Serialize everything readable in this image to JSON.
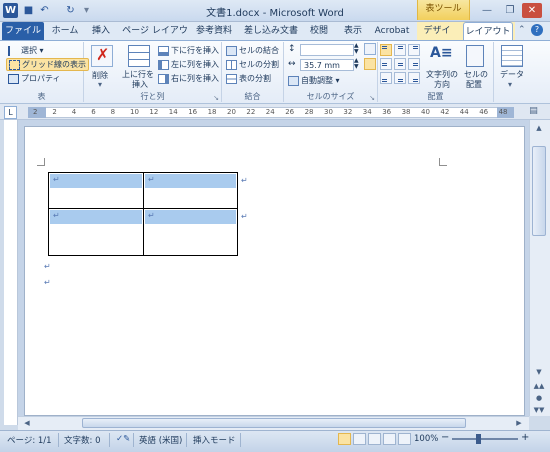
{
  "window": {
    "title": "文書1.docx - Microsoft Word",
    "context_tab_group": "表ツール"
  },
  "tabs": [
    {
      "label": "ファイル"
    },
    {
      "label": "ホーム"
    },
    {
      "label": "挿入"
    },
    {
      "label": "ページ レイアウト"
    },
    {
      "label": "参考資料"
    },
    {
      "label": "差し込み文書"
    },
    {
      "label": "校閲"
    },
    {
      "label": "表示"
    },
    {
      "label": "Acrobat"
    },
    {
      "label": "デザイン"
    },
    {
      "label": "レイアウト",
      "active": true
    }
  ],
  "ribbon": {
    "table": {
      "label": "表",
      "select": "選択",
      "gridlines": "グリッド線の表示",
      "properties": "プロパティ"
    },
    "rows_cols": {
      "label": "行と列",
      "delete": "削除",
      "insert_above_1": "上に行を",
      "insert_above_2": "挿入",
      "insert_below": "下に行を挿入",
      "insert_left": "左に列を挿入",
      "insert_right": "右に列を挿入"
    },
    "merge": {
      "label": "結合",
      "merge_cells": "セルの結合",
      "split_cells": "セルの分割",
      "split_table": "表の分割"
    },
    "cell_size": {
      "label": "セルのサイズ",
      "width_value": "35.7 mm",
      "autofit": "自動調整"
    },
    "alignment": {
      "label": "配置",
      "text_direction_1": "文字列の",
      "text_direction_2": "方向",
      "cell_margins_1": "セルの",
      "cell_margins_2": "配置"
    },
    "data": {
      "label": "データ"
    }
  },
  "ruler": {
    "ticks": [
      "2",
      "2",
      "4",
      "6",
      "8",
      "10",
      "12",
      "14",
      "16",
      "18",
      "20",
      "22",
      "24",
      "26",
      "28",
      "30",
      "32",
      "34",
      "36",
      "38",
      "40",
      "42",
      "44",
      "46",
      "48"
    ]
  },
  "status": {
    "page": "ページ: 1/1",
    "words": "文字数: 0",
    "language": "英語 (米国)",
    "mode": "挿入モード",
    "zoom": "100%",
    "zoom_minus": "−",
    "zoom_plus": "+"
  },
  "colors": {
    "accent": "#2b579a",
    "cell_highlight": "#a9cbee",
    "context_tab": "#f2cf5c"
  }
}
